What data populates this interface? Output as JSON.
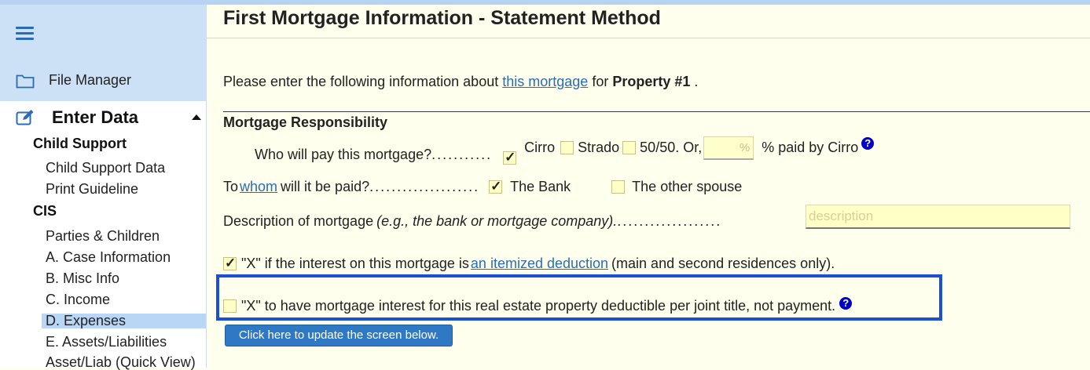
{
  "sidebar": {
    "file_manager": "File Manager",
    "enter_data": "Enter Data",
    "sections": [
      {
        "label": "Child Support"
      },
      {
        "label": "CIS"
      }
    ],
    "items": [
      {
        "label": "Child Support Data"
      },
      {
        "label": "Print Guideline"
      },
      {
        "label": "Parties & Children"
      },
      {
        "label": "A. Case Information"
      },
      {
        "label": "B. Misc Info"
      },
      {
        "label": "C. Income"
      },
      {
        "label": "D. Expenses"
      },
      {
        "label": "E. Assets/Liabilities"
      },
      {
        "label": "Asset/Liab (Quick View)"
      }
    ]
  },
  "main": {
    "title": "First Mortgage Information - Statement Method",
    "intro": {
      "before": "Please enter the following information about",
      "link": "this mortgage",
      "middle": "for",
      "property": "Property #1",
      "after": "."
    },
    "section_heading": "Mortgage Responsibility",
    "who_pays": {
      "label": "Who will pay this mortgage?",
      "dots": "...........",
      "opt1": "Cirro",
      "opt2": "Strado",
      "opt3": "50/50. Or,",
      "pct_placeholder": "%",
      "pct_suffix": "% paid by Cirro"
    },
    "paid_to": {
      "before": "To",
      "link": "whom",
      "after": "will it be paid?",
      "dots": "....................",
      "opt1": "The Bank",
      "opt2": "The other spouse"
    },
    "description": {
      "label": "Description of mortgage",
      "hint": "(e.g., the bank or mortgage company).",
      "dots": "...................",
      "placeholder": "description"
    },
    "itemized": {
      "before": "\"X\" if the interest on this mortgage is",
      "link": "an itemized deduction",
      "after": "(main and second residences only)."
    },
    "joint_title": {
      "label": "\"X\" to have mortgage interest for this real estate property deductible per joint title, not payment."
    },
    "update_button": "Click here to update the screen below.",
    "help_glyph": "?"
  },
  "colors": {
    "accent": "#2a6db5",
    "highlight_border": "#1b4fd4",
    "input_bg": "#ffffc6",
    "page_bg": "#ffffee"
  }
}
